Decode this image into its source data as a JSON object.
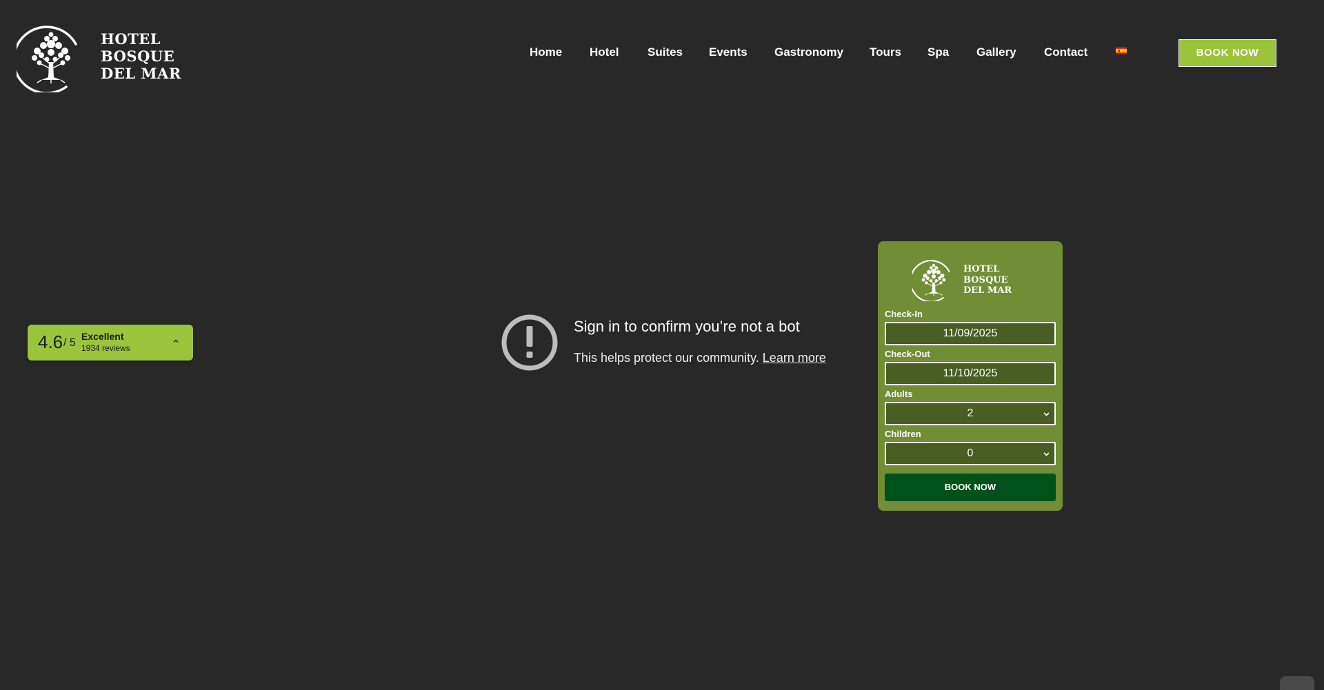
{
  "brand": {
    "lines": [
      "HOTEL",
      "BOSQUE",
      "DEL MAR"
    ]
  },
  "nav": {
    "items": [
      {
        "label": "Home"
      },
      {
        "label": "Hotel"
      },
      {
        "label": "Suites"
      },
      {
        "label": "Events"
      },
      {
        "label": "Gastronomy"
      },
      {
        "label": "Tours"
      },
      {
        "label": "Spa"
      },
      {
        "label": "Gallery"
      },
      {
        "label": "Contact"
      }
    ],
    "language_icon": "spain-flag-icon",
    "book_label": "BOOK NOW"
  },
  "rating": {
    "score": "4.6",
    "out_of": "/ 5",
    "label": "Excellent",
    "count": "1934 reviews",
    "toggle_icon": "chevron-up-icon"
  },
  "bot_check": {
    "icon": "alert-circle-icon",
    "title": "Sign in to confirm you’re not a bot",
    "text": "This helps protect our community.",
    "link": "Learn more"
  },
  "booking": {
    "brand_lines": [
      "HOTEL",
      "BOSQUE",
      "DEL MAR"
    ],
    "checkin": {
      "label": "Check-In",
      "value": "11/09/2025"
    },
    "checkout": {
      "label": "Check-Out",
      "value": "11/10/2025"
    },
    "adults": {
      "label": "Adults",
      "value": "2"
    },
    "children": {
      "label": "Children",
      "value": "0"
    },
    "book_label": "BOOK NOW"
  },
  "colors": {
    "background": "#282828",
    "accent_green": "#9ac43c",
    "widget_green": "#718d36",
    "field_green": "#4a5d23",
    "book_button": "#00511a"
  }
}
